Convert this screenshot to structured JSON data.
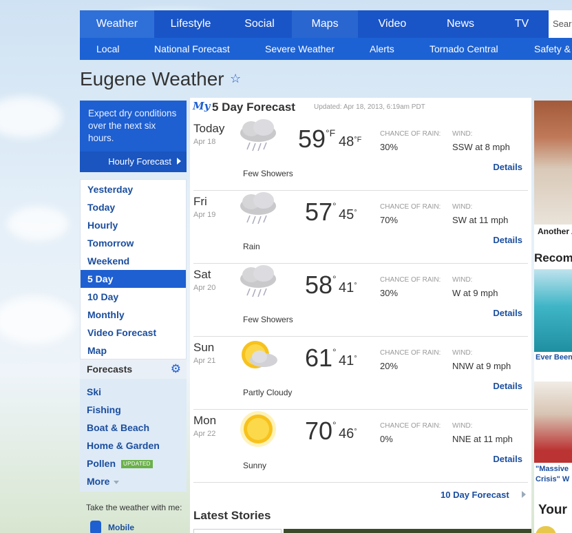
{
  "nav": {
    "tabs": [
      "Weather",
      "Lifestyle",
      "Social",
      "Maps",
      "Video",
      "News",
      "TV"
    ],
    "search_placeholder": "Search",
    "sub": [
      "Local",
      "National Forecast",
      "Severe Weather",
      "Alerts",
      "Tornado Central",
      "Safety & Prep"
    ]
  },
  "page": {
    "title": "Eugene Weather"
  },
  "sidebar": {
    "message": "Expect dry conditions over the next six hours.",
    "hourly_link": "Hourly Forecast",
    "items": [
      "Yesterday",
      "Today",
      "Hourly",
      "Tomorrow",
      "Weekend",
      "5 Day",
      "10 Day",
      "Monthly",
      "Video Forecast",
      "Map"
    ],
    "active_item": "5 Day",
    "forecasts_heading": "Forecasts",
    "forecast_items": [
      "Ski",
      "Fishing",
      "Boat & Beach",
      "Home & Garden",
      "Pollen",
      "More"
    ],
    "updated_badge": "UPDATED",
    "take_weather": "Take the weather with me:",
    "mobile": "Mobile"
  },
  "forecast": {
    "my_label": "My",
    "title": "5 Day Forecast",
    "updated": "Updated: Apr 18, 2013, 6:19am PDT",
    "rain_label": "CHANCE OF RAIN:",
    "wind_label": "WIND:",
    "details_label": "Details",
    "days": [
      {
        "name": "Today",
        "date": "Apr 18",
        "icon": "rain-cloud-icon",
        "condition": "Few Showers",
        "hi": "59",
        "hi_unit": "°F",
        "lo": "48",
        "lo_unit": "°F",
        "rain": "30%",
        "wind": "SSW at 8 mph"
      },
      {
        "name": "Fri",
        "date": "Apr 19",
        "icon": "rain-cloud-icon",
        "condition": "Rain",
        "hi": "57",
        "hi_unit": "°",
        "lo": "45",
        "lo_unit": "°",
        "rain": "70%",
        "wind": "SW at 11 mph"
      },
      {
        "name": "Sat",
        "date": "Apr 20",
        "icon": "rain-cloud-icon",
        "condition": "Few Showers",
        "hi": "58",
        "hi_unit": "°",
        "lo": "41",
        "lo_unit": "°",
        "rain": "30%",
        "wind": "W at 9 mph"
      },
      {
        "name": "Sun",
        "date": "Apr 21",
        "icon": "partly-cloudy-icon",
        "condition": "Partly Cloudy",
        "hi": "61",
        "hi_unit": "°",
        "lo": "41",
        "lo_unit": "°",
        "rain": "20%",
        "wind": "NNW at 9 mph"
      },
      {
        "name": "Mon",
        "date": "Apr 22",
        "icon": "sun-icon",
        "condition": "Sunny",
        "hi": "70",
        "hi_unit": "°",
        "lo": "46",
        "lo_unit": "°",
        "rain": "0%",
        "wind": "NNE at 11 mph"
      }
    ],
    "ten_day": "10 Day Forecast",
    "latest": "Latest Stories"
  },
  "rail": {
    "caption1": "Another A",
    "heading": "Recom",
    "caption2": "Ever Been",
    "caption3a": "\"Massive",
    "caption3b": "Crisis\" W",
    "heading2": "Your"
  },
  "colors": {
    "nav_blue": "#1a55c8",
    "link_blue": "#1a4d9e",
    "active_blue": "#1e5fd1",
    "badge_green": "#6bb04a"
  }
}
